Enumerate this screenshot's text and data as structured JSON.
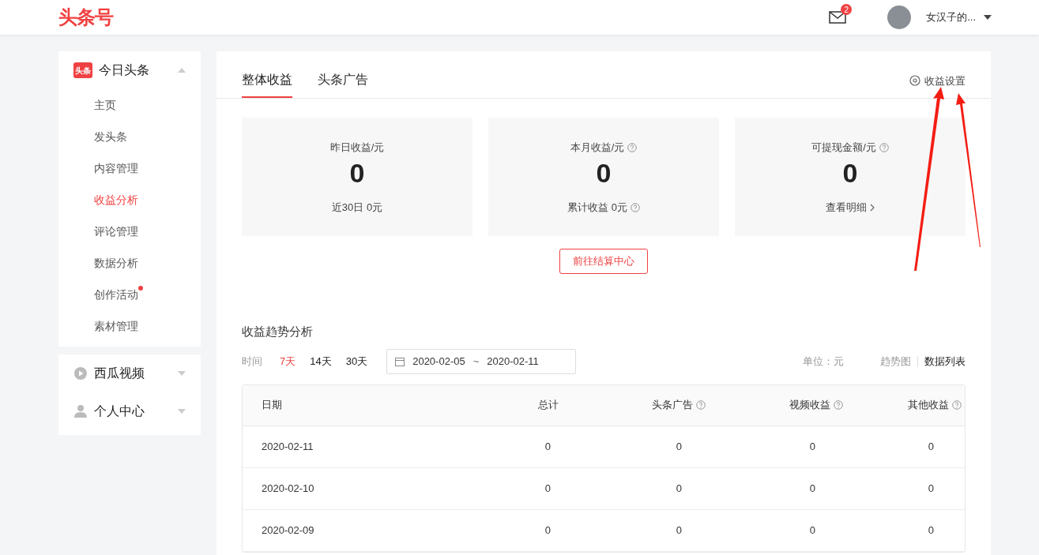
{
  "header": {
    "logo": "头条号",
    "messages_badge": "2",
    "user_name": "女汉子的..."
  },
  "sidebar": [
    {
      "kind": "toutiao",
      "icon_text": "头条",
      "label": "今日头条",
      "expanded": true,
      "items": [
        {
          "label": "主页",
          "selected": false,
          "dot": false
        },
        {
          "label": "发头条",
          "selected": false,
          "dot": false
        },
        {
          "label": "内容管理",
          "selected": false,
          "dot": false
        },
        {
          "label": "收益分析",
          "selected": true,
          "dot": false
        },
        {
          "label": "评论管理",
          "selected": false,
          "dot": false
        },
        {
          "label": "数据分析",
          "selected": false,
          "dot": false
        },
        {
          "label": "创作活动",
          "selected": false,
          "dot": true
        },
        {
          "label": "素材管理",
          "selected": false,
          "dot": false
        }
      ]
    },
    {
      "kind": "video",
      "label": "西瓜视频",
      "expanded": false
    },
    {
      "kind": "person",
      "label": "个人中心",
      "expanded": false
    }
  ],
  "tabs": [
    {
      "label": "整体收益",
      "selected": true
    },
    {
      "label": "头条广告",
      "selected": false
    }
  ],
  "settings_link": "收益设置",
  "stat_cards": [
    {
      "label": "昨日收益/元",
      "label_help": false,
      "value": "0",
      "footer": "近30日 0元",
      "footer_help": false,
      "footer_link": false
    },
    {
      "label": "本月收益/元",
      "label_help": true,
      "value": "0",
      "footer": "累计收益 0元",
      "footer_help": true,
      "footer_link": false
    },
    {
      "label": "可提现金额/元",
      "label_help": true,
      "value": "0",
      "footer": "查看明细",
      "footer_help": false,
      "footer_link": true
    }
  ],
  "settlement_button": "前往结算中心",
  "trend": {
    "title": "收益趋势分析",
    "time_label": "时间",
    "ranges": [
      {
        "label": "7天",
        "selected": true
      },
      {
        "label": "14天",
        "selected": false
      },
      {
        "label": "30天",
        "selected": false
      }
    ],
    "date_start": "2020-02-05",
    "date_separator": "~",
    "date_end": "2020-02-11",
    "unit": "单位：元",
    "views": [
      {
        "label": "趋势图",
        "selected": false
      },
      {
        "label": "数据列表",
        "selected": true
      }
    ]
  },
  "table": {
    "columns": [
      {
        "label": "日期",
        "help": false
      },
      {
        "label": "总计",
        "help": false
      },
      {
        "label": "头条广告",
        "help": true
      },
      {
        "label": "视频收益",
        "help": true
      },
      {
        "label": "其他收益",
        "help": true
      }
    ],
    "rows": [
      [
        "2020-02-11",
        "0",
        "0",
        "0",
        "0"
      ],
      [
        "2020-02-10",
        "0",
        "0",
        "0",
        "0"
      ],
      [
        "2020-02-09",
        "0",
        "0",
        "0",
        "0"
      ]
    ]
  }
}
